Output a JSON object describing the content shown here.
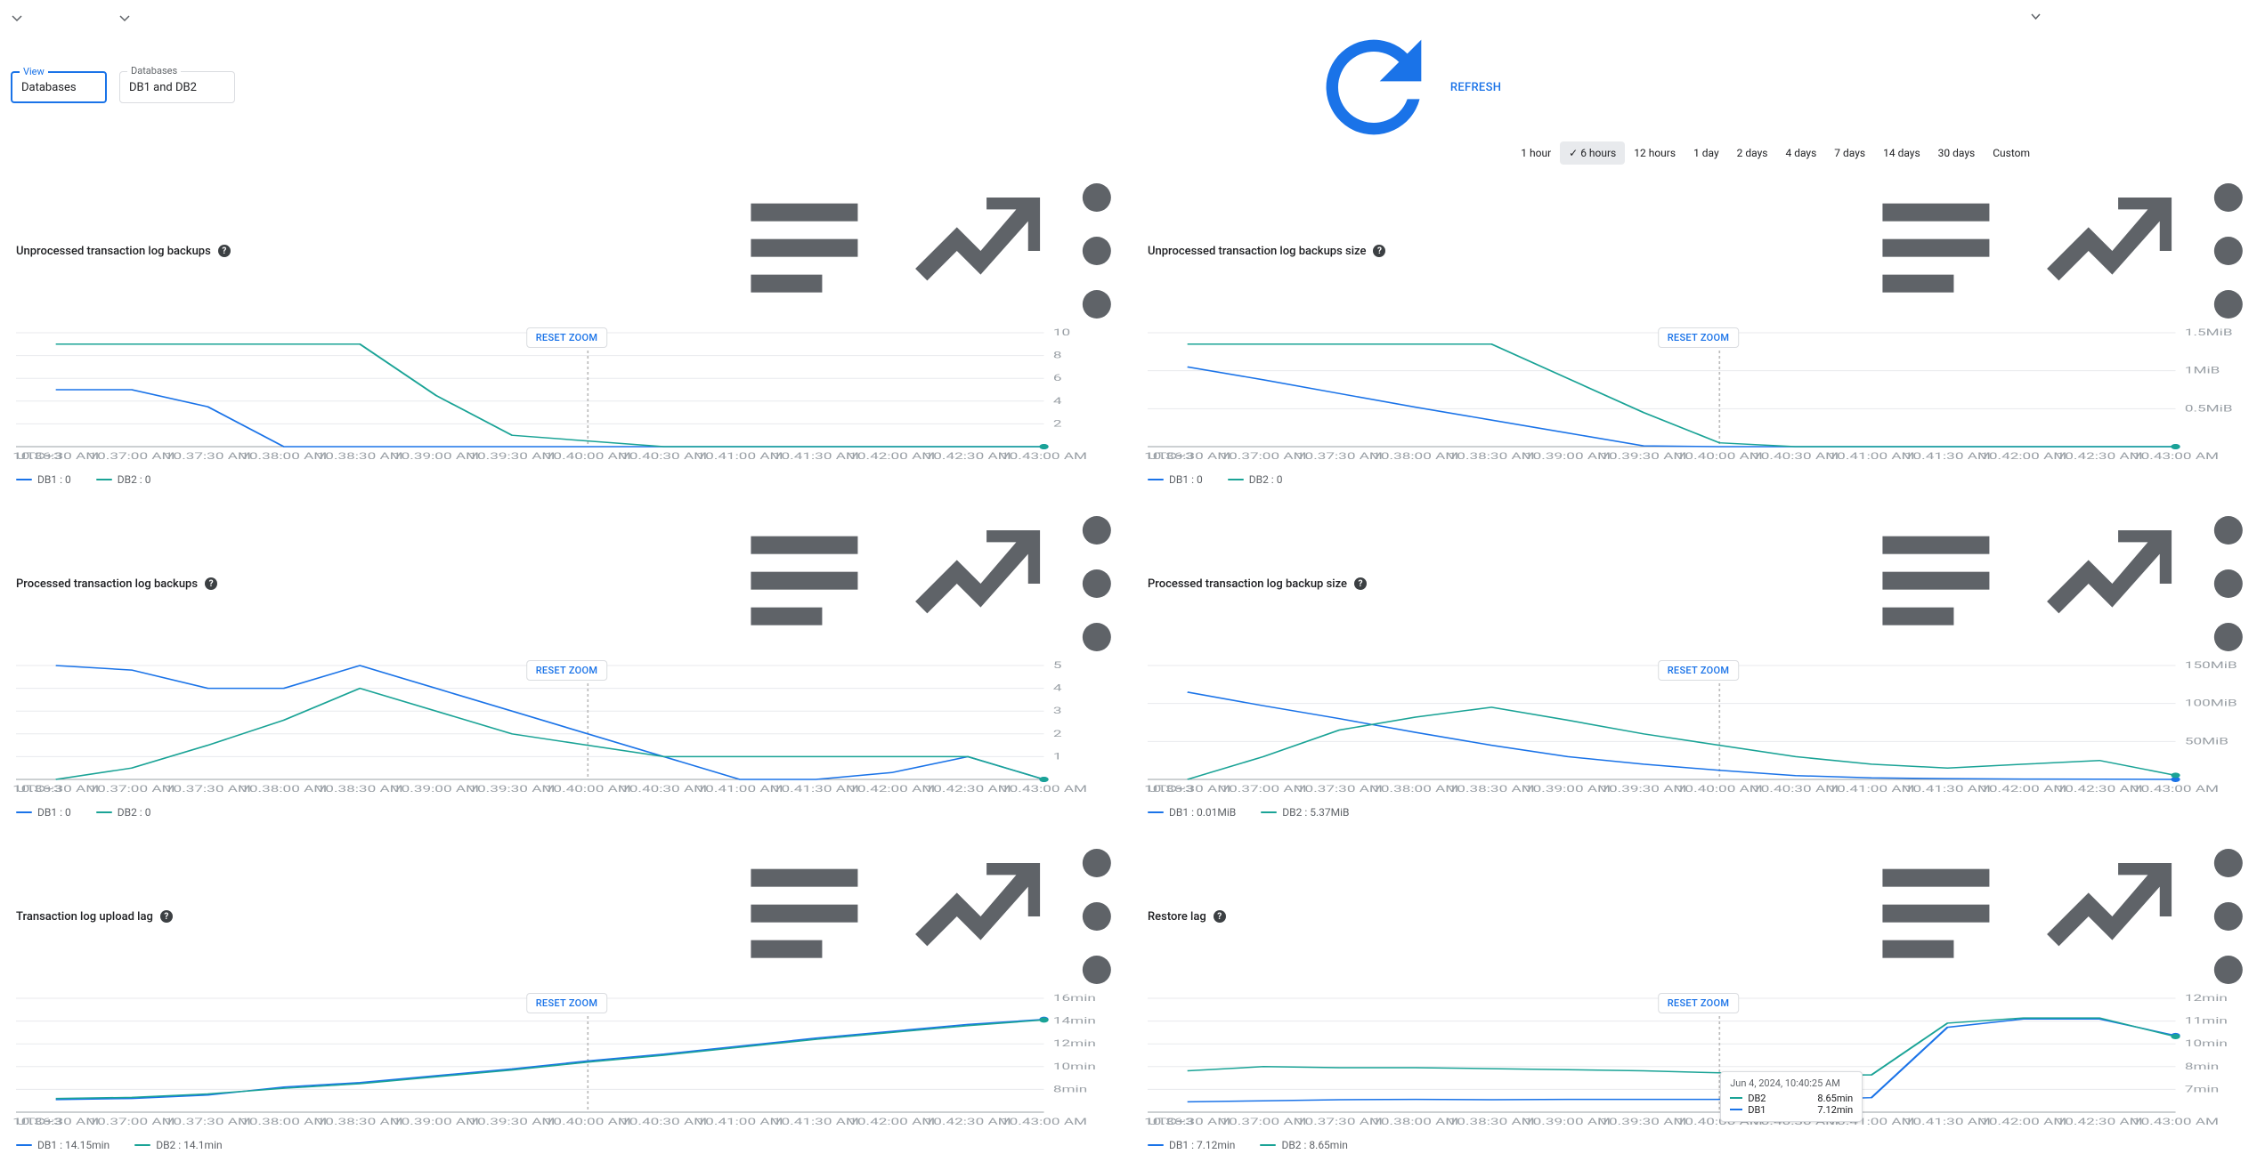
{
  "colors": {
    "db1": "#1a73e8",
    "db2": "#1aa396"
  },
  "filters": {
    "view": {
      "label": "View",
      "value": "Databases"
    },
    "databases": {
      "label": "Databases",
      "value": "DB1 and DB2"
    }
  },
  "refresh": "REFRESH",
  "time_ranges": [
    "1 hour",
    "6 hours",
    "12 hours",
    "1 day",
    "2 days",
    "4 days",
    "7 days",
    "14 days",
    "30 days",
    "Custom"
  ],
  "selected_range": "6 hours",
  "x": {
    "tz": "UTC+3",
    "labels": [
      "10.36:30 AM",
      "10.37:00 AM",
      "10.37:30 AM",
      "10.38:00 AM",
      "10.38:30 AM",
      "10.39:00 AM",
      "10.39:30 AM",
      "10.40:00 AM",
      "10.40:30 AM",
      "10.41:00 AM",
      "10.41:30 AM",
      "10.42:00 AM",
      "10.42:30 AM",
      "10.43:00 AM"
    ]
  },
  "charts": [
    {
      "id": "unproc-count",
      "title": "Unprocessed transaction log backups",
      "reset": "RESET ZOOM",
      "y": {
        "ticks": [
          "10",
          "8",
          "6",
          "4",
          "2"
        ],
        "max": 10
      },
      "legend": [
        {
          "name": "DB1",
          "val": "0",
          "c": "db1"
        },
        {
          "name": "DB2",
          "val": "0",
          "c": "db2"
        }
      ],
      "chart_data": {
        "type": "line",
        "x": "shared",
        "marker_idx": 7,
        "series": [
          {
            "name": "DB1",
            "color": "#1a73e8",
            "values": [
              5,
              5,
              3.5,
              0,
              0,
              0,
              0,
              0,
              0,
              0,
              0,
              0,
              0,
              0
            ]
          },
          {
            "name": "DB2",
            "color": "#1aa396",
            "values": [
              9,
              9,
              9,
              9,
              9,
              4.5,
              1,
              0.5,
              0,
              0,
              0,
              0,
              0,
              0
            ]
          }
        ]
      }
    },
    {
      "id": "unproc-size",
      "title": "Unprocessed transaction log backups size",
      "reset": "RESET ZOOM",
      "y": {
        "ticks": [
          "1.5MiB",
          "1MiB",
          "0.5MiB"
        ],
        "max": 1.5
      },
      "legend": [
        {
          "name": "DB1",
          "val": "0",
          "c": "db1"
        },
        {
          "name": "DB2",
          "val": "0",
          "c": "db2"
        }
      ],
      "chart_data": {
        "type": "line",
        "x": "shared",
        "marker_idx": 7,
        "series": [
          {
            "name": "DB1",
            "color": "#1a73e8",
            "values": [
              1.05,
              0.88,
              0.7,
              0.52,
              0.35,
              0.18,
              0.01,
              0,
              0,
              0,
              0,
              0,
              0,
              0
            ]
          },
          {
            "name": "DB2",
            "color": "#1aa396",
            "values": [
              1.35,
              1.35,
              1.35,
              1.35,
              1.35,
              0.9,
              0.45,
              0.05,
              0,
              0,
              0,
              0,
              0,
              0
            ]
          }
        ]
      }
    },
    {
      "id": "proc-count",
      "title": "Processed transaction log backups",
      "reset": "RESET ZOOM",
      "y": {
        "ticks": [
          "5",
          "4",
          "3",
          "2",
          "1"
        ],
        "max": 5
      },
      "legend": [
        {
          "name": "DB1",
          "val": "0",
          "c": "db1"
        },
        {
          "name": "DB2",
          "val": "0",
          "c": "db2"
        }
      ],
      "chart_data": {
        "type": "line",
        "x": "shared",
        "marker_idx": 7,
        "series": [
          {
            "name": "DB1",
            "color": "#1a73e8",
            "values": [
              5,
              4.8,
              4,
              4,
              5,
              4,
              3,
              2,
              1,
              0,
              0,
              0.3,
              1,
              0
            ]
          },
          {
            "name": "DB2",
            "color": "#1aa396",
            "values": [
              0,
              0.5,
              1.5,
              2.6,
              4,
              3,
              2,
              1.5,
              1,
              1,
              1,
              1,
              1,
              0
            ]
          }
        ]
      }
    },
    {
      "id": "proc-size",
      "title": "Processed transaction log backup size",
      "reset": "RESET ZOOM",
      "y": {
        "ticks": [
          "150MiB",
          "100MiB",
          "50MiB"
        ],
        "max": 150
      },
      "legend": [
        {
          "name": "DB1",
          "val": "0.01MiB",
          "c": "db1"
        },
        {
          "name": "DB2",
          "val": "5.37MiB",
          "c": "db2"
        }
      ],
      "chart_data": {
        "type": "line",
        "x": "shared",
        "marker_idx": 7,
        "series": [
          {
            "name": "DB1",
            "color": "#1a73e8",
            "values": [
              115,
              97,
              80,
              62,
              45,
              30,
              20,
              12,
              5,
              2,
              1,
              0.5,
              0.2,
              0.01
            ]
          },
          {
            "name": "DB2",
            "color": "#1aa396",
            "values": [
              0,
              30,
              65,
              82,
              95,
              78,
              60,
              45,
              30,
              20,
              15,
              20,
              25,
              5.37
            ]
          }
        ]
      }
    },
    {
      "id": "upload-lag",
      "title": "Transaction log upload lag",
      "reset": "RESET ZOOM",
      "y": {
        "ticks": [
          "16min",
          "14min",
          "12min",
          "10min",
          "8min"
        ],
        "max": 16,
        "min": 6
      },
      "legend": [
        {
          "name": "DB1",
          "val": "14.15min",
          "c": "db1"
        },
        {
          "name": "DB2",
          "val": "14.1min",
          "c": "db2"
        }
      ],
      "chart_data": {
        "type": "line",
        "x": "shared",
        "marker_idx": 7,
        "series": [
          {
            "name": "DB1",
            "color": "#1a73e8",
            "values": [
              7.1,
              7.2,
              7.5,
              8.2,
              8.6,
              9.2,
              9.8,
              10.5,
              11.1,
              11.8,
              12.5,
              13.1,
              13.7,
              14.15
            ]
          },
          {
            "name": "DB2",
            "color": "#1aa396",
            "values": [
              7.2,
              7.3,
              7.6,
              8.1,
              8.5,
              9.1,
              9.7,
              10.4,
              11,
              11.7,
              12.4,
              13,
              13.6,
              14.1
            ]
          }
        ]
      }
    },
    {
      "id": "restore-lag",
      "title": "Restore lag",
      "reset": "RESET ZOOM",
      "y": {
        "ticks": [
          "12min",
          "11min",
          "10min",
          "8min",
          "7min"
        ],
        "max": 12,
        "min": 6.5
      },
      "legend": [
        {
          "name": "DB1",
          "val": "7.12min",
          "c": "db1"
        },
        {
          "name": "DB2",
          "val": "8.65min",
          "c": "db2"
        }
      ],
      "chart_data": {
        "type": "line",
        "x": "shared",
        "marker_idx": 7,
        "series": [
          {
            "name": "DB1",
            "color": "#1a73e8",
            "values": [
              7.0,
              7.05,
              7.1,
              7.12,
              7.1,
              7.12,
              7.12,
              7.12,
              7.1,
              7.2,
              10.6,
              11.0,
              11.0,
              10.2
            ]
          },
          {
            "name": "DB2",
            "color": "#1aa396",
            "values": [
              8.5,
              8.7,
              8.65,
              8.65,
              8.6,
              8.55,
              8.5,
              8.4,
              8.3,
              8.3,
              10.8,
              11.05,
              11.05,
              10.15
            ]
          }
        ]
      },
      "tooltip": {
        "time": "Jun 4, 2024, 10:40:25 AM",
        "rows": [
          {
            "c": "db2",
            "name": "DB2",
            "val": "8.65min"
          },
          {
            "c": "db1",
            "name": "DB1",
            "val": "7.12min"
          }
        ]
      }
    }
  ]
}
